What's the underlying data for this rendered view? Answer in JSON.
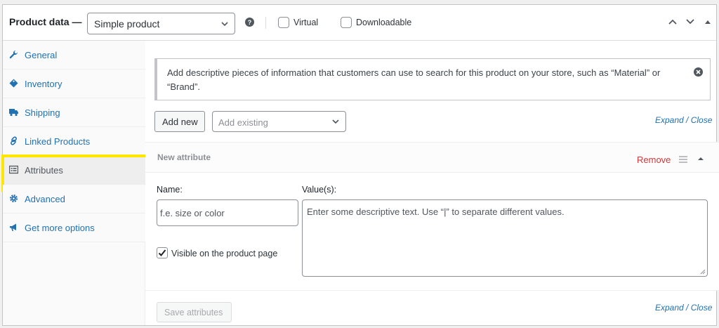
{
  "header": {
    "title": "Product data —",
    "product_type": "Simple product",
    "virtual_label": "Virtual",
    "downloadable_label": "Downloadable"
  },
  "sidebar": {
    "items": [
      {
        "label": "General",
        "icon": "wrench-icon"
      },
      {
        "label": "Inventory",
        "icon": "tag-icon"
      },
      {
        "label": "Shipping",
        "icon": "truck-icon"
      },
      {
        "label": "Linked Products",
        "icon": "link-icon"
      },
      {
        "label": "Attributes",
        "icon": "list-icon",
        "active": true
      },
      {
        "label": "Advanced",
        "icon": "gear-icon"
      },
      {
        "label": "Get more options",
        "icon": "megaphone-icon"
      }
    ]
  },
  "notice": {
    "text": "Add descriptive pieces of information that customers can use to search for this product on your store, such as “Material” or “Brand”."
  },
  "toolbar": {
    "add_new": "Add new",
    "add_existing_placeholder": "Add existing",
    "expand": "Expand",
    "separator": " / ",
    "close": "Close"
  },
  "attribute": {
    "title": "New attribute",
    "remove": "Remove",
    "name_label": "Name:",
    "name_placeholder": "f.e. size or color",
    "values_label": "Value(s):",
    "values_placeholder": "Enter some descriptive text. Use “|” to separate different values.",
    "visible_label": "Visible on the product page",
    "visible_checked": true
  },
  "footer": {
    "save": "Save attributes",
    "expand": "Expand",
    "separator": " / ",
    "close": "Close"
  },
  "colors": {
    "link": "#2271b1",
    "danger": "#d63638",
    "highlight": "#ffe600"
  }
}
